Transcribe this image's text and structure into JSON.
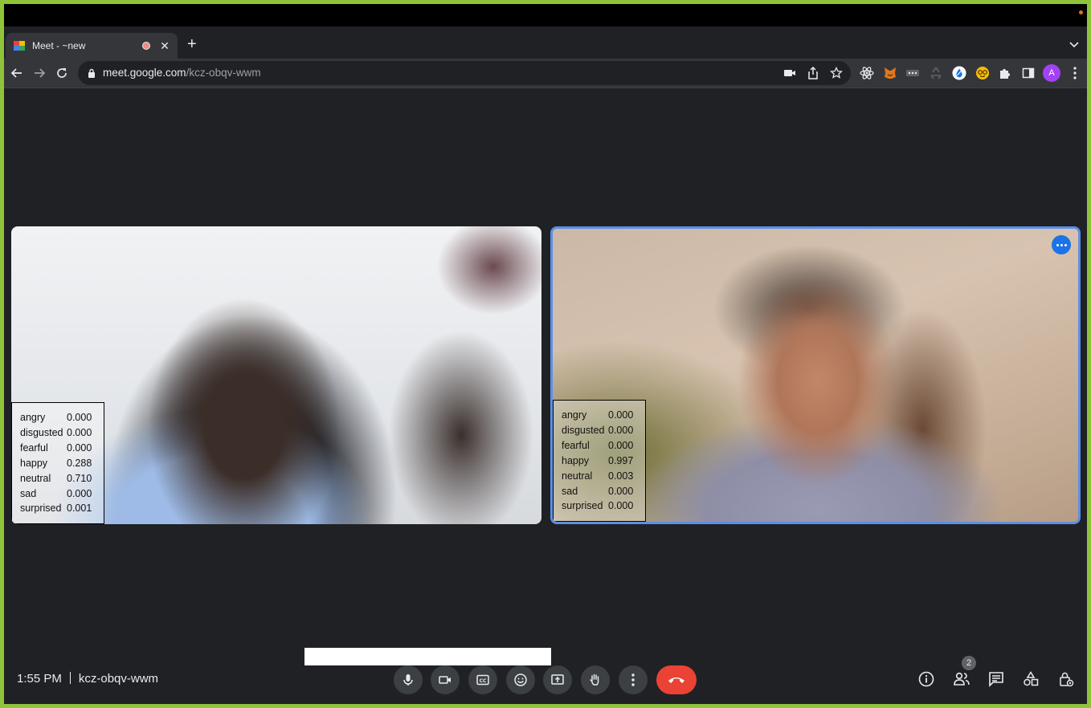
{
  "browser": {
    "tab": {
      "title": "Meet - ~new",
      "close_label": "✕"
    },
    "new_tab_label": "+",
    "address": {
      "host": "meet.google.com",
      "path": "/kcz-obqv-wwm"
    },
    "profile_initial": "A"
  },
  "participants": [
    {
      "emotions": [
        {
          "label": "angry",
          "value": "0.000"
        },
        {
          "label": "disgusted",
          "value": "0.000"
        },
        {
          "label": "fearful",
          "value": "0.000"
        },
        {
          "label": "happy",
          "value": "0.288"
        },
        {
          "label": "neutral",
          "value": "0.710"
        },
        {
          "label": "sad",
          "value": "0.000"
        },
        {
          "label": "surprised",
          "value": "0.001"
        }
      ]
    },
    {
      "active_speaker": true,
      "emotions": [
        {
          "label": "angry",
          "value": "0.000"
        },
        {
          "label": "disgusted",
          "value": "0.000"
        },
        {
          "label": "fearful",
          "value": "0.000"
        },
        {
          "label": "happy",
          "value": "0.997"
        },
        {
          "label": "neutral",
          "value": "0.003"
        },
        {
          "label": "sad",
          "value": "0.000"
        },
        {
          "label": "surprised",
          "value": "0.000"
        }
      ]
    }
  ],
  "meeting": {
    "time": "1:55 PM",
    "code": "kcz-obqv-wwm",
    "participant_count": "2"
  },
  "icons": {
    "controls": [
      "mic-icon",
      "camera-icon",
      "captions-icon",
      "emoji-icon",
      "present-icon",
      "raise-hand-icon",
      "more-options-icon",
      "hangup-icon"
    ],
    "right": [
      "info-icon",
      "people-icon",
      "chat-icon",
      "activities-icon",
      "host-controls-icon"
    ]
  },
  "colors": {
    "hangup": "#ea4335",
    "active_border": "#5b8fe6",
    "background": "#202124",
    "window_border": "#8fc43a"
  }
}
